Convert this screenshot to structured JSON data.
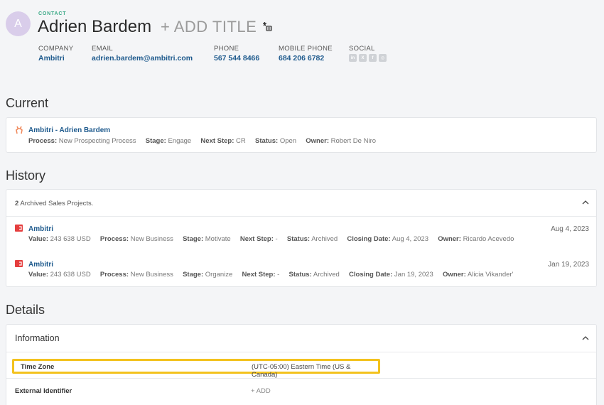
{
  "contact": {
    "initial": "A",
    "tag": "CONTACT",
    "name": "Adrien Bardem",
    "add_title": "+ ADD TITLE"
  },
  "fields": {
    "company_label": "COMPANY",
    "company_value": "Ambitri",
    "email_label": "EMAIL",
    "email_value": "adrien.bardem@ambitri.com",
    "phone_label": "PHONE",
    "phone_value": "567 544 8466",
    "mobile_label": "MOBILE PHONE",
    "mobile_value": "684 206 6782",
    "social_label": "SOCIAL",
    "social_icons": [
      "linkedin-icon",
      "x-icon",
      "facebook-icon",
      "instagram-icon"
    ]
  },
  "current": {
    "title": "Current",
    "project": {
      "name": "Ambitri - Adrien Bardem",
      "process_label": "Process:",
      "process_value": "New Prospecting Process",
      "stage_label": "Stage:",
      "stage_value": "Engage",
      "next_label": "Next Step:",
      "next_value": "CR",
      "status_label": "Status:",
      "status_value": "Open",
      "owner_label": "Owner:",
      "owner_value": "Robert De Niro"
    }
  },
  "history": {
    "title": "History",
    "count": "2",
    "count_text": "Archived Sales Projects.",
    "rows": [
      {
        "name": "Ambitri",
        "value_label": "Value:",
        "value": "243 638 USD",
        "process_label": "Process:",
        "process": "New Business",
        "stage_label": "Stage:",
        "stage": "Motivate",
        "next_label": "Next Step:",
        "next": "-",
        "status_label": "Status:",
        "status": "Archived",
        "closing_label": "Closing Date:",
        "closing": "Aug 4, 2023",
        "owner_label": "Owner:",
        "owner": "Ricardo Acevedo",
        "date": "Aug 4, 2023"
      },
      {
        "name": "Ambitri",
        "value_label": "Value:",
        "value": "243 638 USD",
        "process_label": "Process:",
        "process": "New Business",
        "stage_label": "Stage:",
        "stage": "Organize",
        "next_label": "Next Step:",
        "next": "-",
        "status_label": "Status:",
        "status": "Archived",
        "closing_label": "Closing Date:",
        "closing": "Jan 19, 2023",
        "owner_label": "Owner:",
        "owner": "Alicia Vikander'",
        "date": "Jan 19, 2023"
      }
    ]
  },
  "details": {
    "title": "Details",
    "information_title": "Information",
    "timezone_label": "Time Zone",
    "timezone_value": "(UTC-05:00) Eastern Time (US & Canada)",
    "external_label": "External Identifier",
    "external_add": "+ ADD"
  },
  "colors": {
    "accent": "#1e5a8d",
    "contact_tag": "#3aa986",
    "highlight": "#f3c21e",
    "archived_icon": "#e53e3e",
    "current_icon": "#f08a5d"
  }
}
